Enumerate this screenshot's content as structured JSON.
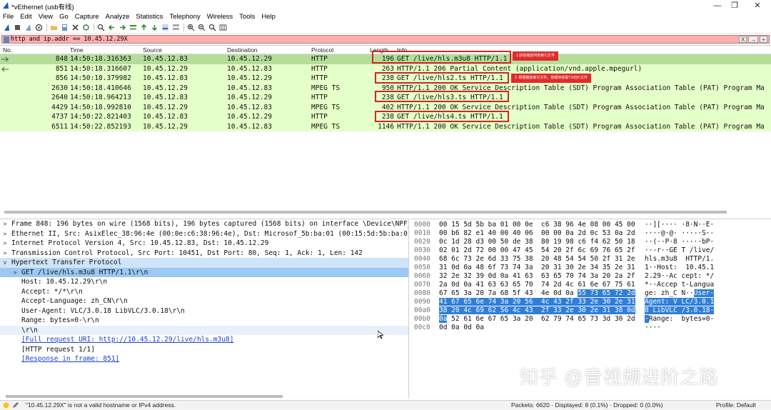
{
  "window": {
    "title": "*vEthernet (usb有线)"
  },
  "menu": [
    "File",
    "Edit",
    "View",
    "Go",
    "Capture",
    "Analyze",
    "Statistics",
    "Telephony",
    "Wireless",
    "Tools",
    "Help"
  ],
  "filter": {
    "value": "http and ip.addr == 10.45.12.29X",
    "bookmark_label": "X",
    "arrow_label": "→",
    "expression_label": "+"
  },
  "columns": [
    "No.",
    "Time",
    "Source",
    "Destination",
    "Protocol",
    "Length",
    "Info"
  ],
  "packets": [
    {
      "no": "848",
      "time": "14:50:18.316363",
      "src": "10.45.12.83",
      "dst": "10.45.12.29",
      "proto": "HTTP",
      "len": "196",
      "info": "GET /live/hls.m3u8 HTTP/1.1"
    },
    {
      "no": "851",
      "time": "14:50:18.316607",
      "src": "10.45.12.29",
      "dst": "10.45.12.83",
      "proto": "HTTP",
      "len": "263",
      "info": "HTTP/1.1 206 Partial Content  (application/vnd.apple.mpegurl)"
    },
    {
      "no": "856",
      "time": "14:50:18.379982",
      "src": "10.45.12.83",
      "dst": "10.45.12.29",
      "proto": "HTTP",
      "len": "238",
      "info": "GET /live/hls2.ts HTTP/1.1"
    },
    {
      "no": "2630",
      "time": "14:50:18.410646",
      "src": "10.45.12.29",
      "dst": "10.45.12.83",
      "proto": "MPEG TS",
      "len": "950",
      "info": "HTTP/1.1 200 OK  Service Description Table (SDT)  Program Association Table (PAT)  Program Ma"
    },
    {
      "no": "2640",
      "time": "14:50:18.964213",
      "src": "10.45.12.83",
      "dst": "10.45.12.29",
      "proto": "HTTP",
      "len": "238",
      "info": "GET /live/hls3.ts HTTP/1.1"
    },
    {
      "no": "4429",
      "time": "14:50:18.992810",
      "src": "10.45.12.29",
      "dst": "10.45.12.83",
      "proto": "MPEG TS",
      "len": "402",
      "info": "HTTP/1.1 200 OK  Service Description Table (SDT)  Program Association Table (PAT)  Program Ma"
    },
    {
      "no": "4737",
      "time": "14:50:22.821403",
      "src": "10.45.12.83",
      "dst": "10.45.12.29",
      "proto": "HTTP",
      "len": "238",
      "info": "GET /live/hls4.ts HTTP/1.1"
    },
    {
      "no": "6511",
      "time": "14:50:22.852193",
      "src": "10.45.12.29",
      "dst": "10.45.12.83",
      "proto": "MPEG TS",
      "len": "1146",
      "info": "HTTP/1.1 200 OK  Service Description Table (SDT)  Program Association Table (PAT)  Program Ma"
    }
  ],
  "annotations": {
    "note1": "1.获取播放列表索引文件",
    "note2": "2. 根据播放索引文件，按顺序获取TS切片文件"
  },
  "details": [
    {
      "arrow": ">",
      "text": "Frame 848: 196 bytes on wire (1568 bits), 196 bytes captured (1568 bits) on interface \\Device\\NPF_{"
    },
    {
      "arrow": ">",
      "text": "Ethernet II, Src: AsixElec_38:96:4e (00:0e:c6:38:96:4e), Dst: Microsof_5b:ba:01 (00:15:5d:5b:ba:01)"
    },
    {
      "arrow": ">",
      "text": "Internet Protocol Version 4, Src: 10.45.12.83, Dst: 10.45.12.29"
    },
    {
      "arrow": ">",
      "text": "Transmission Control Protocol, Src Port: 10451, Dst Port: 80, Seq: 1, Ack: 1, Len: 142"
    },
    {
      "arrow": "v",
      "text": "Hypertext Transfer Protocol"
    },
    {
      "arrow": ">",
      "text": "GET /live/hls.m3u8 HTTP/1.1\\r\\n"
    },
    {
      "arrow": "",
      "text": "Host: 10.45.12.29\\r\\n"
    },
    {
      "arrow": "",
      "text": "Accept: */*\\r\\n"
    },
    {
      "arrow": "",
      "text": "Accept-Language: zh_CN\\r\\n"
    },
    {
      "arrow": "",
      "text": "User-Agent: VLC/3.0.18 LibVLC/3.0.18\\r\\n"
    },
    {
      "arrow": "",
      "text": "Range: bytes=0-\\r\\n"
    },
    {
      "arrow": "",
      "text": "\\r\\n"
    },
    {
      "arrow": "",
      "text": "[Full request URI: http://10.45.12.29/live/hls.m3u8]"
    },
    {
      "arrow": "",
      "text": "[HTTP request 1/1]"
    },
    {
      "arrow": "",
      "text": "[Response in frame: 851]"
    }
  ],
  "bytes": [
    {
      "off": "0000",
      "hex": "00 15 5d 5b ba 01 00 0e  c6 38 96 4e 08 00 45 00",
      "ascii": "··][···· ·8·N··E·"
    },
    {
      "off": "0010",
      "hex": "00 b6 82 e1 40 00 40 06  00 00 0a 2d 0c 53 0a 2d",
      "ascii": "····@·@· ···-·S·-"
    },
    {
      "off": "0020",
      "hex": "0c 1d 28 d3 00 50 de 38  80 19 98 c6 f4 62 50 18",
      "ascii": "··(··P·8 ·····bP·"
    },
    {
      "off": "0030",
      "hex": "02 01 2d 72 00 00 47 45  54 20 2f 6c 69 76 65 2f",
      "ascii": "··-r··GE T /live/"
    },
    {
      "off": "0040",
      "hex": "68 6c 73 2e 6d 33 75 38  20 48 54 54 50 2f 31 2e",
      "ascii": "hls.m3u8  HTTP/1."
    },
    {
      "off": "0050",
      "hex": "31 0d 0a 48 6f 73 74 3a  20 31 30 2e 34 35 2e 31",
      "ascii": "1··Host:  10.45.1"
    },
    {
      "off": "0060",
      "hex": "32 2e 32 39 0d 0a 41 63  63 65 70 74 3a 20 2a 2f",
      "ascii": "2.29··Ac cept: */"
    },
    {
      "off": "0070",
      "hex": "2a 0d 0a 41 63 63 65 70  74 2d 4c 61 6e 67 75 61",
      "ascii": "*··Accep t-Langua"
    },
    {
      "off": "0080",
      "hex_plain": "67 65 3a 20 7a 68 5f 43  4e 0d 0a ",
      "hex_hl": "55 73 65 72 2d",
      "ascii_plain": "ge: zh_C N··",
      "ascii_hl": "User-"
    },
    {
      "off": "0090",
      "hex_hl": "41 67 65 6e 74 3a 20 56  4c 43 2f 33 2e 30 2e 31",
      "ascii_hl": "Agent: V LC/3.0.1"
    },
    {
      "off": "00a0",
      "hex_hl": "38 20 4c 69 62 56 4c 43  2f 33 2e 30 2e 31 38 0d",
      "ascii_hl": "8 LibVLC /3.0.18·"
    },
    {
      "off": "00b0",
      "hex_hl": "0a",
      "hex_plain": " 52 61 6e 67 65 3a 20  62 79 74 65 73 3d 30 2d",
      "ascii_hl": "·",
      "ascii_plain": "Range:  bytes=0-"
    },
    {
      "off": "00c0",
      "hex": "0d 0a 0d 0a",
      "ascii": "····"
    }
  ],
  "status": {
    "message": "\"10.45.12.29X\" is not a valid hostname or IPv4 address.",
    "packets": "Packets: 6620 · Displayed: 8 (0.1%) · Dropped: 0 (0.0%)",
    "profile": "Profile: Default"
  },
  "watermark": "知乎 @音视频进阶之路",
  "colors": {
    "filter_invalid": "#ffafaf",
    "http_row": "#e4ffc7",
    "selected_row": "#b5dd9a",
    "annotation_red": "#d32424",
    "bytes_highlight": "#2f7ed8",
    "detail_selected": "#9cc9f3"
  }
}
